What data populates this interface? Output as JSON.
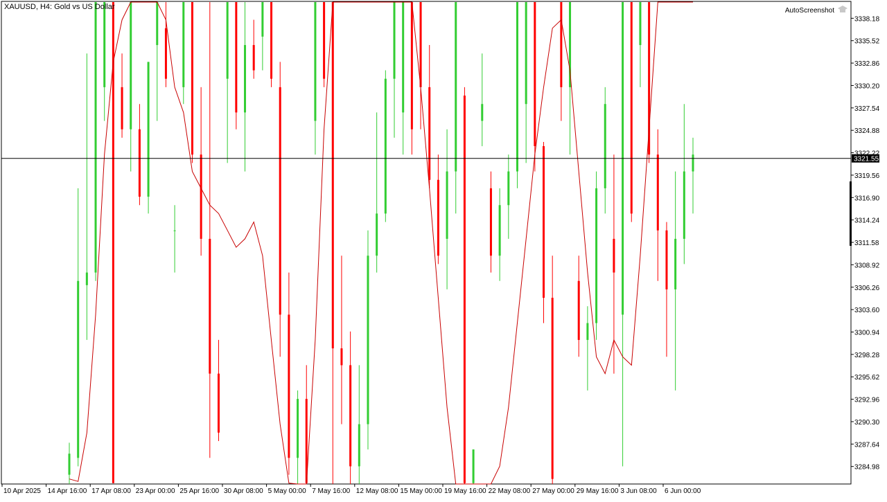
{
  "window": {
    "symbol_title": "XAUUSD, H4:  Gold vs US Dollar",
    "badge_label": "AutoScreenshot",
    "badge_icon": "graduation-cap-icon"
  },
  "colors": {
    "background": "#ffffff",
    "frame": "#000000",
    "bull": "#32cd32",
    "bear": "#ff0000",
    "ma_line": "#c80000",
    "crosshair": "#000000",
    "price_tag_bg": "#000000",
    "price_tag_fg": "#ffffff",
    "text": "#000000"
  },
  "chart_data": {
    "type": "candlestick",
    "y_ticks": [
      "3338.18",
      "3335.52",
      "3332.86",
      "3330.20",
      "3327.54",
      "3324.88",
      "3322.22",
      "3319.56",
      "3316.90",
      "3314.24",
      "3311.58",
      "3308.92",
      "3306.26",
      "3303.60",
      "3300.94",
      "3298.28",
      "3295.62",
      "3292.96",
      "3290.30",
      "3287.64",
      "3284.98"
    ],
    "ylim": [
      3282.9,
      3340.1
    ],
    "current_price": 3321.55,
    "current_price_label": "3321.55",
    "x_labels": [
      "10 Apr 2025",
      "14 Apr 16:00",
      "17 Apr 08:00",
      "23 Apr 00:00",
      "25 Apr 16:00",
      "30 Apr 08:00",
      "5 May 00:00",
      "7 May 16:00",
      "12 May 08:00",
      "15 May 00:00",
      "19 May 16:00",
      "22 May 08:00",
      "27 May 00:00",
      "29 May 16:00",
      "3 Jun 08:00",
      "6 Jun 00:00"
    ],
    "candles": [
      {
        "o": 3284.0,
        "h": 3287.8,
        "l": 3282.9,
        "c": 3286.5
      },
      {
        "o": 3286.0,
        "h": 3318.0,
        "l": 3285.0,
        "c": 3307.0
      },
      {
        "o": 3306.5,
        "h": 3334.0,
        "l": 3300.0,
        "c": 3308.0
      },
      {
        "o": 3308.0,
        "h": 3340.1,
        "l": 3307.0,
        "c": 3340.1
      },
      {
        "o": 3330.0,
        "h": 3340.1,
        "l": 3326.0,
        "c": 3340.1
      },
      {
        "o": 3340.1,
        "h": 3340.1,
        "l": 3283.0,
        "c": 3283.0
      },
      {
        "o": 3330.0,
        "h": 3334.0,
        "l": 3324.0,
        "c": 3325.0
      },
      {
        "o": 3325.0,
        "h": 3340.1,
        "l": 3320.0,
        "c": 3340.1
      },
      {
        "o": 3325.0,
        "h": 3328.0,
        "l": 3316.0,
        "c": 3317.0
      },
      {
        "o": 3317.0,
        "h": 3333.0,
        "l": 3315.0,
        "c": 3333.0
      },
      {
        "o": 3335.0,
        "h": 3340.1,
        "l": 3326.0,
        "c": 3340.1
      },
      {
        "o": 3337.0,
        "h": 3340.1,
        "l": 3330.0,
        "c": 3331.0
      },
      {
        "o": 3313.0,
        "h": 3316.0,
        "l": 3308.0,
        "c": 3313.0
      },
      {
        "o": 3330.0,
        "h": 3340.1,
        "l": 3328.0,
        "c": 3340.1
      },
      {
        "o": 3340.1,
        "h": 3340.1,
        "l": 3321.0,
        "c": 3322.0
      },
      {
        "o": 3322.0,
        "h": 3330.0,
        "l": 3310.0,
        "c": 3312.0
      },
      {
        "o": 3312.0,
        "h": 3340.1,
        "l": 3286.0,
        "c": 3296.0
      },
      {
        "o": 3296.0,
        "h": 3300.0,
        "l": 3288.0,
        "c": 3289.0
      },
      {
        "o": 3331.0,
        "h": 3340.1,
        "l": 3321.0,
        "c": 3340.1
      },
      {
        "o": 3340.1,
        "h": 3340.1,
        "l": 3325.0,
        "c": 3327.0
      },
      {
        "o": 3327.0,
        "h": 3340.1,
        "l": 3320.0,
        "c": 3335.0
      },
      {
        "o": 3335.0,
        "h": 3338.0,
        "l": 3331.0,
        "c": 3332.0
      },
      {
        "o": 3336.0,
        "h": 3340.1,
        "l": 3332.0,
        "c": 3340.1
      },
      {
        "o": 3340.1,
        "h": 3340.1,
        "l": 3330.0,
        "c": 3331.0
      },
      {
        "o": 3330.0,
        "h": 3333.0,
        "l": 3298.0,
        "c": 3303.0
      },
      {
        "o": 3303.0,
        "h": 3308.0,
        "l": 3284.0,
        "c": 3286.0
      },
      {
        "o": 3286.0,
        "h": 3294.0,
        "l": 3282.9,
        "c": 3293.0
      },
      {
        "o": 3293.0,
        "h": 3297.0,
        "l": 3282.9,
        "c": 3283.0
      },
      {
        "o": 3326.0,
        "h": 3340.1,
        "l": 3322.0,
        "c": 3340.1
      },
      {
        "o": 3340.1,
        "h": 3340.1,
        "l": 3330.0,
        "c": 3331.0
      },
      {
        "o": 3340.1,
        "h": 3340.1,
        "l": 3282.9,
        "c": 3299.0
      },
      {
        "o": 3299.0,
        "h": 3310.0,
        "l": 3290.0,
        "c": 3297.0
      },
      {
        "o": 3297.0,
        "h": 3301.0,
        "l": 3282.9,
        "c": 3285.0
      },
      {
        "o": 3285.0,
        "h": 3297.0,
        "l": 3282.9,
        "c": 3290.0
      },
      {
        "o": 3290.0,
        "h": 3313.0,
        "l": 3287.0,
        "c": 3310.0
      },
      {
        "o": 3310.0,
        "h": 3327.0,
        "l": 3308.0,
        "c": 3315.0
      },
      {
        "o": 3315.0,
        "h": 3332.0,
        "l": 3314.0,
        "c": 3331.0
      },
      {
        "o": 3331.0,
        "h": 3340.1,
        "l": 3324.0,
        "c": 3340.1
      },
      {
        "o": 3327.0,
        "h": 3340.1,
        "l": 3322.0,
        "c": 3340.1
      },
      {
        "o": 3340.1,
        "h": 3340.1,
        "l": 3322.0,
        "c": 3325.0
      },
      {
        "o": 3340.1,
        "h": 3340.1,
        "l": 3325.0,
        "c": 3330.0
      },
      {
        "o": 3330.0,
        "h": 3335.0,
        "l": 3318.0,
        "c": 3319.0
      },
      {
        "o": 3319.0,
        "h": 3322.0,
        "l": 3309.0,
        "c": 3310.0
      },
      {
        "o": 3312.0,
        "h": 3325.0,
        "l": 3306.0,
        "c": 3320.0
      },
      {
        "o": 3320.0,
        "h": 3340.1,
        "l": 3315.0,
        "c": 3340.1
      },
      {
        "o": 3329.0,
        "h": 3330.0,
        "l": 3282.9,
        "c": 3283.0
      },
      {
        "o": 3283.0,
        "h": 3287.0,
        "l": 3282.9,
        "c": 3287.0
      },
      {
        "o": 3326.0,
        "h": 3334.0,
        "l": 3323.0,
        "c": 3328.0
      },
      {
        "o": 3318.0,
        "h": 3320.0,
        "l": 3308.0,
        "c": 3310.0
      },
      {
        "o": 3310.0,
        "h": 3318.0,
        "l": 3307.0,
        "c": 3316.0
      },
      {
        "o": 3316.0,
        "h": 3322.0,
        "l": 3312.0,
        "c": 3320.0
      },
      {
        "o": 3320.0,
        "h": 3340.1,
        "l": 3318.0,
        "c": 3340.1
      },
      {
        "o": 3328.0,
        "h": 3340.1,
        "l": 3321.0,
        "c": 3340.1
      },
      {
        "o": 3340.1,
        "h": 3340.1,
        "l": 3320.0,
        "c": 3323.0
      },
      {
        "o": 3323.0,
        "h": 3323.5,
        "l": 3302.0,
        "c": 3305.0
      },
      {
        "o": 3305.0,
        "h": 3310.0,
        "l": 3282.9,
        "c": 3283.5
      },
      {
        "o": 3340.1,
        "h": 3340.1,
        "l": 3326.0,
        "c": 3330.0
      },
      {
        "o": 3330.0,
        "h": 3340.1,
        "l": 3322.0,
        "c": 3340.1
      },
      {
        "o": 3307.0,
        "h": 3310.0,
        "l": 3298.0,
        "c": 3300.0
      },
      {
        "o": 3300.0,
        "h": 3304.0,
        "l": 3294.0,
        "c": 3302.0
      },
      {
        "o": 3302.0,
        "h": 3320.0,
        "l": 3300.0,
        "c": 3318.0
      },
      {
        "o": 3318.0,
        "h": 3330.0,
        "l": 3315.0,
        "c": 3328.0
      },
      {
        "o": 3312.0,
        "h": 3322.0,
        "l": 3296.0,
        "c": 3308.0
      },
      {
        "o": 3303.0,
        "h": 3340.1,
        "l": 3285.0,
        "c": 3340.1
      },
      {
        "o": 3340.1,
        "h": 3340.1,
        "l": 3314.0,
        "c": 3315.0
      },
      {
        "o": 3335.0,
        "h": 3340.1,
        "l": 3330.0,
        "c": 3340.1
      },
      {
        "o": 3340.1,
        "h": 3340.1,
        "l": 3321.0,
        "c": 3322.0
      },
      {
        "o": 3322.0,
        "h": 3325.0,
        "l": 3307.0,
        "c": 3313.0
      },
      {
        "o": 3313.0,
        "h": 3314.0,
        "l": 3298.0,
        "c": 3306.0
      },
      {
        "o": 3306.0,
        "h": 3320.0,
        "l": 3294.0,
        "c": 3312.0
      },
      {
        "o": 3312.0,
        "h": 3328.0,
        "l": 3309.0,
        "c": 3320.0
      },
      {
        "o": 3320.0,
        "h": 3324.0,
        "l": 3315.0,
        "c": 3322.0
      }
    ],
    "ma_line": [
      3283.5,
      3283.2,
      3289.0,
      3303.0,
      3322.0,
      3333.0,
      3338.0,
      3340.1,
      3340.1,
      3340.1,
      3340.1,
      3338.0,
      3330.0,
      3327.0,
      3320.0,
      3318.0,
      3316.0,
      3315.0,
      3313.0,
      3311.0,
      3312.0,
      3314.0,
      3310.0,
      3300.0,
      3290.0,
      3283.0,
      3282.9,
      3282.9,
      3300.0,
      3325.0,
      3340.1,
      3340.1,
      3340.1,
      3340.1,
      3340.1,
      3340.1,
      3340.1,
      3340.1,
      3340.1,
      3340.1,
      3330.0,
      3318.0,
      3305.0,
      3292.0,
      3282.9,
      3282.9,
      3282.9,
      3282.9,
      3282.9,
      3285.0,
      3292.0,
      3302.0,
      3312.0,
      3322.0,
      3330.0,
      3337.0,
      3338.0,
      3332.0,
      3320.0,
      3308.0,
      3298.0,
      3296.0,
      3300.0,
      3298.0,
      3297.0,
      3310.0,
      3325.0,
      3340.1,
      3340.1,
      3340.1,
      3340.1,
      3340.1
    ]
  }
}
